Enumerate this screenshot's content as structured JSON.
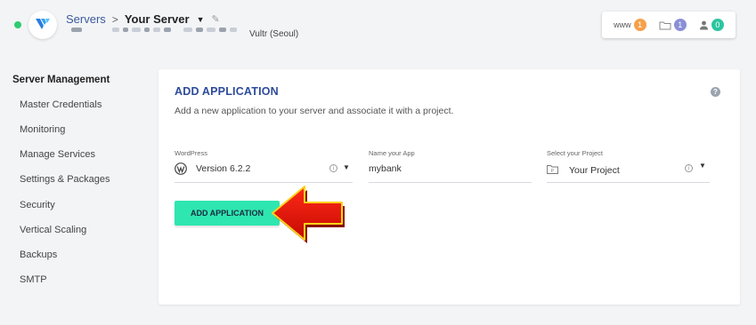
{
  "header": {
    "crumb_servers": "Servers",
    "crumb_sep": ">",
    "server_name": "Your Server",
    "provider": "Vultr (Seoul)"
  },
  "counters": [
    {
      "label": "www",
      "count": "1",
      "color": "#f5a04b"
    },
    {
      "icon": "folder-icon",
      "count": "1",
      "color": "#8a8fd6"
    },
    {
      "icon": "user-icon",
      "count": "0",
      "color": "#2bc5a0"
    }
  ],
  "sidebar": {
    "title": "Server Management",
    "items": [
      {
        "label": "Master Credentials"
      },
      {
        "label": "Monitoring"
      },
      {
        "label": "Manage Services"
      },
      {
        "label": "Settings & Packages"
      },
      {
        "label": "Security"
      },
      {
        "label": "Vertical Scaling"
      },
      {
        "label": "Backups"
      },
      {
        "label": "SMTP"
      }
    ]
  },
  "panel": {
    "title": "ADD APPLICATION",
    "description": "Add a new application to your server and associate it with a project.",
    "help": "?",
    "app_type": {
      "label": "WordPress",
      "value": "Version 6.2.2"
    },
    "app_name": {
      "label": "Name your App",
      "value": "mybank"
    },
    "project": {
      "label": "Select your Project",
      "value": "Your Project"
    },
    "button": "ADD APPLICATION"
  }
}
